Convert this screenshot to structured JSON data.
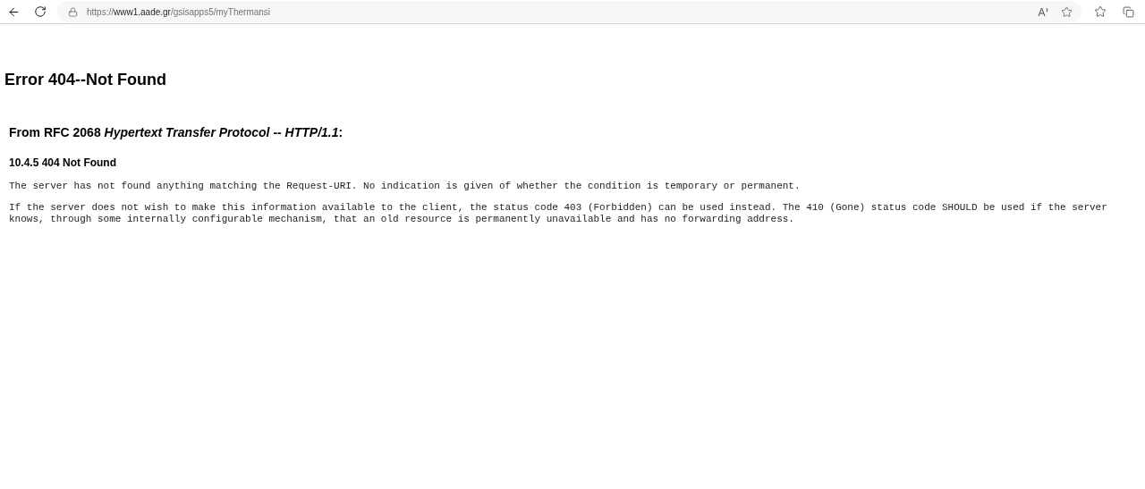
{
  "browser": {
    "url": {
      "scheme": "https://",
      "domain": "www1.aade.gr",
      "path": "/gsisapps5/myThermansi"
    }
  },
  "page": {
    "title": "Error 404--Not Found",
    "source": "From RFC 2068 *Hypertext Transfer Protocol -- HTTP/1.1*:",
    "section": "10.4.5 404 Not Found",
    "paragraphs": [
      "The server has not found anything matching the Request-URI. No indication is given of whether the condition is temporary or permanent.",
      "If the server does not wish to make this information available to the client, the status code 403 (Forbidden) can be used instead. The 410 (Gone) status code SHOULD be used if the server knows, through some internally configurable mechanism, that an old resource is permanently unavailable and has no forwarding address."
    ]
  }
}
